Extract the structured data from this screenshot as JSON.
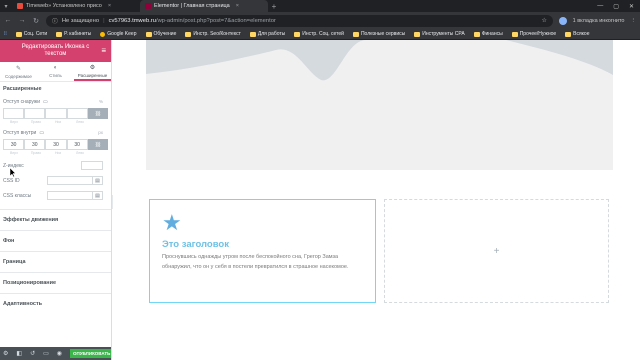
{
  "browser": {
    "tabs": [
      {
        "label": "Timeweb» Установлено присо",
        "active": false,
        "fav_color": "#e74c3c"
      },
      {
        "label": "Elementor | Главная страница",
        "active": true,
        "fav_color": "#92003b"
      }
    ],
    "new_tab": "+",
    "address": {
      "security": "Не защищено",
      "host": "cv57963.tmweb.ru",
      "path": "/wp-admin/post.php?post=7&action=elementor"
    },
    "incognito_label": "1 вкладка инкогнито"
  },
  "bookmarks": [
    {
      "label": "Соц. Сети",
      "type": "folder"
    },
    {
      "label": "Р. кабинеты",
      "type": "folder"
    },
    {
      "label": "Google Keep",
      "type": "site"
    },
    {
      "label": "Обучение",
      "type": "folder"
    },
    {
      "label": "Инстр. Seo/Контекст",
      "type": "folder"
    },
    {
      "label": "Для работы",
      "type": "folder"
    },
    {
      "label": "Инстр. Соц. сетей",
      "type": "folder"
    },
    {
      "label": "Полезные сервисы",
      "type": "folder"
    },
    {
      "label": "Инструменты CPA",
      "type": "folder"
    },
    {
      "label": "Финансы",
      "type": "folder"
    },
    {
      "label": "Прочее/Нужное",
      "type": "folder"
    },
    {
      "label": "Всякое",
      "type": "folder"
    }
  ],
  "panel": {
    "header_title": "Редактировать Иконка с текстом",
    "tabs": [
      {
        "label": "Содержимое",
        "icon": "pencil-icon",
        "active": false
      },
      {
        "label": "Стиль",
        "icon": "contrast-icon",
        "active": false
      },
      {
        "label": "Расширенные",
        "icon": "gear-icon",
        "active": true
      }
    ],
    "section_title": "Расширенные",
    "margin": {
      "label": "Отступ снаружи",
      "unit": "%",
      "values": [
        "",
        "",
        "",
        ""
      ],
      "sub_labels": [
        "Верх",
        "Право",
        "Низ",
        "Лево"
      ]
    },
    "padding": {
      "label": "Отступ внутри",
      "unit": "px",
      "values": [
        "30",
        "30",
        "30",
        "30"
      ],
      "sub_labels": [
        "Верх",
        "Право",
        "Низ",
        "Лево"
      ]
    },
    "z_index_label": "Z-индекс",
    "css_id_label": "CSS ID",
    "css_classes_label": "CSS классы",
    "accordions": [
      "Эффекты движения",
      "Фон",
      "Граница",
      "Позиционирование",
      "Адаптивность"
    ],
    "publish_label": "ОПУБЛИКОВАТЬ"
  },
  "canvas": {
    "iconbox": {
      "title": "Это заголовок",
      "text": "Проснувшись однажды утром после беспокойного сна, Грегор Замза обнаружил, что он у себя в постели превратился в страшное насекомое.",
      "icon": "star-icon",
      "title_color": "#6ec1e4"
    },
    "empty_column_icon": "+"
  },
  "colors": {
    "elementor_brand": "#d5416e",
    "publish_green": "#39b54a",
    "accent_blue": "#6ec1e4"
  }
}
